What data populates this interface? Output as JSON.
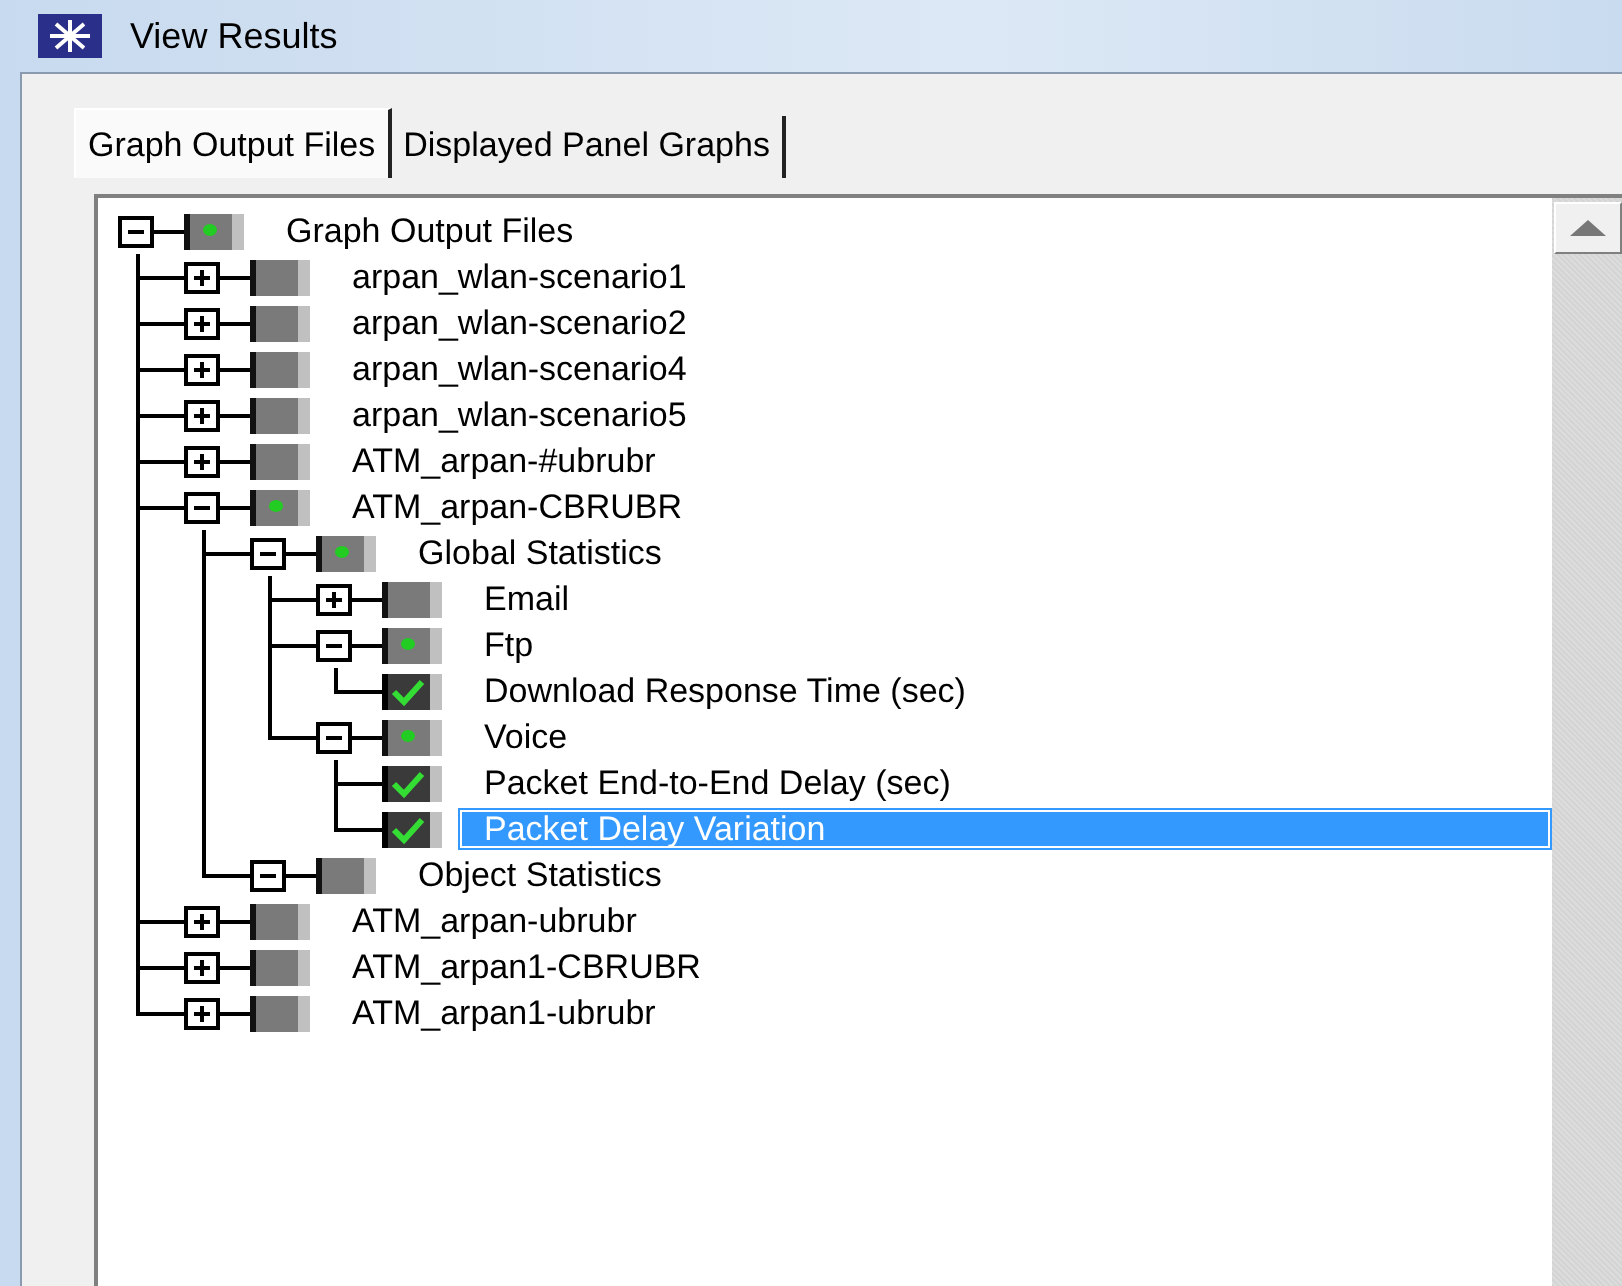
{
  "window": {
    "title": "View Results"
  },
  "tabs": [
    {
      "label": "Graph Output Files",
      "selected": true
    },
    {
      "label": "Displayed Panel Graphs",
      "selected": false
    }
  ],
  "tree": [
    {
      "label": "Graph Output Files",
      "kind": "group",
      "expanded": true,
      "checked": true,
      "selected": false,
      "children": [
        {
          "label": "arpan_wlan-scenario1",
          "kind": "group",
          "expanded": false,
          "checked": false,
          "selected": false
        },
        {
          "label": "arpan_wlan-scenario2",
          "kind": "group",
          "expanded": false,
          "checked": false,
          "selected": false
        },
        {
          "label": "arpan_wlan-scenario4",
          "kind": "group",
          "expanded": false,
          "checked": false,
          "selected": false
        },
        {
          "label": "arpan_wlan-scenario5",
          "kind": "group",
          "expanded": false,
          "checked": false,
          "selected": false
        },
        {
          "label": "ATM_arpan-#ubrubr",
          "kind": "group",
          "expanded": false,
          "checked": false,
          "selected": false
        },
        {
          "label": "ATM_arpan-CBRUBR",
          "kind": "group",
          "expanded": true,
          "checked": true,
          "selected": false,
          "children": [
            {
              "label": "Global Statistics",
              "kind": "group",
              "expanded": true,
              "checked": true,
              "selected": false,
              "children": [
                {
                  "label": "Email",
                  "kind": "group",
                  "expanded": false,
                  "checked": false,
                  "selected": false
                },
                {
                  "label": "Ftp",
                  "kind": "group",
                  "expanded": true,
                  "checked": true,
                  "selected": false,
                  "children": [
                    {
                      "label": "Download Response Time (sec)",
                      "kind": "statistic",
                      "checked": true,
                      "selected": false
                    }
                  ]
                },
                {
                  "label": "Voice",
                  "kind": "group",
                  "expanded": true,
                  "checked": true,
                  "selected": false,
                  "children": [
                    {
                      "label": "Packet End-to-End Delay (sec)",
                      "kind": "statistic",
                      "checked": true,
                      "selected": false
                    },
                    {
                      "label": "Packet Delay Variation",
                      "kind": "statistic",
                      "checked": true,
                      "selected": true
                    }
                  ]
                }
              ]
            },
            {
              "label": "Object Statistics",
              "kind": "group",
              "expanded": true,
              "checked": false,
              "selected": false
            }
          ]
        },
        {
          "label": "ATM_arpan-ubrubr",
          "kind": "group",
          "expanded": false,
          "checked": false,
          "selected": false
        },
        {
          "label": "ATM_arpan1-CBRUBR",
          "kind": "group",
          "expanded": false,
          "checked": false,
          "selected": false
        },
        {
          "label": "ATM_arpan1-ubrubr",
          "kind": "group",
          "expanded": false,
          "checked": false,
          "selected": false
        }
      ]
    }
  ]
}
